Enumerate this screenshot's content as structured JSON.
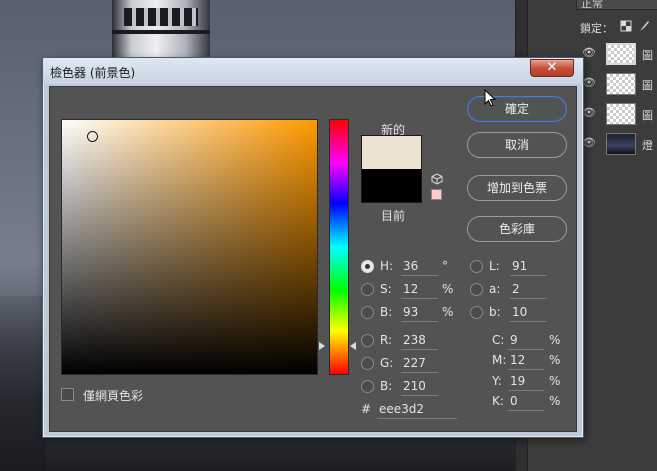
{
  "background": {
    "layers_panel": {
      "blend_mode": "正常",
      "lock_label": "鎖定：",
      "layers": [
        {
          "name": "圖",
          "visible": true,
          "selected": true
        },
        {
          "name": "圖",
          "visible": true,
          "selected": false
        },
        {
          "name": "圖",
          "visible": true,
          "selected": false
        },
        {
          "name": "燈",
          "visible": true,
          "selected": false
        }
      ]
    }
  },
  "dialog": {
    "title": "檢色器 (前景色)",
    "close_glyph": "✕",
    "new_label": "新的",
    "current_label": "目前",
    "new_color": "#eee3d2",
    "current_color": "#000000",
    "buttons": {
      "ok": "確定",
      "cancel": "取消",
      "add_to_swatches": "增加到色票",
      "color_libraries": "色彩庫"
    },
    "web_only_label": "僅網頁色彩",
    "hsb": {
      "h": {
        "label": "H:",
        "value": "36",
        "unit": "°"
      },
      "s": {
        "label": "S:",
        "value": "12",
        "unit": "%"
      },
      "b": {
        "label": "B:",
        "value": "93",
        "unit": "%"
      }
    },
    "rgb": {
      "r": {
        "label": "R:",
        "value": "238"
      },
      "g": {
        "label": "G:",
        "value": "227"
      },
      "b": {
        "label": "B:",
        "value": "210"
      }
    },
    "lab": {
      "l": {
        "label": "L:",
        "value": "91"
      },
      "a": {
        "label": "a:",
        "value": "2"
      },
      "b": {
        "label": "b:",
        "value": "10"
      }
    },
    "cmyk": {
      "c": {
        "label": "C:",
        "value": "9",
        "unit": "%"
      },
      "m": {
        "label": "M:",
        "value": "12",
        "unit": "%"
      },
      "y": {
        "label": "Y:",
        "value": "19",
        "unit": "%"
      },
      "k": {
        "label": "K:",
        "value": "0",
        "unit": "%"
      }
    },
    "hex": {
      "prefix": "#",
      "value": "eee3d2"
    },
    "selected_channel": "H"
  },
  "icons": {
    "cube": "gamut-warning-cube-icon",
    "eye": "visibility-eye-icon",
    "cursor": "mouse-pointer-icon"
  }
}
